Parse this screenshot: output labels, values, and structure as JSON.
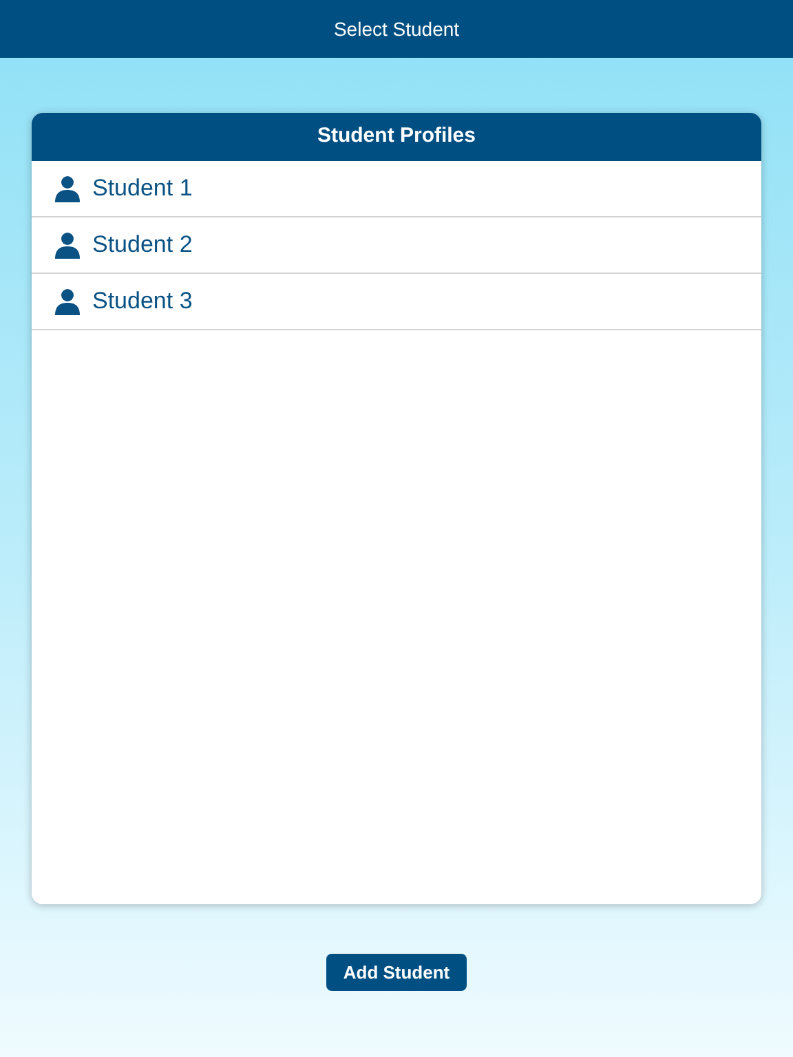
{
  "top_bar": {
    "title": "Select Student"
  },
  "panel": {
    "title": "Student Profiles",
    "students": [
      {
        "name": "Student 1"
      },
      {
        "name": "Student 2"
      },
      {
        "name": "Student 3"
      }
    ]
  },
  "add_button": {
    "label": "Add Student"
  }
}
